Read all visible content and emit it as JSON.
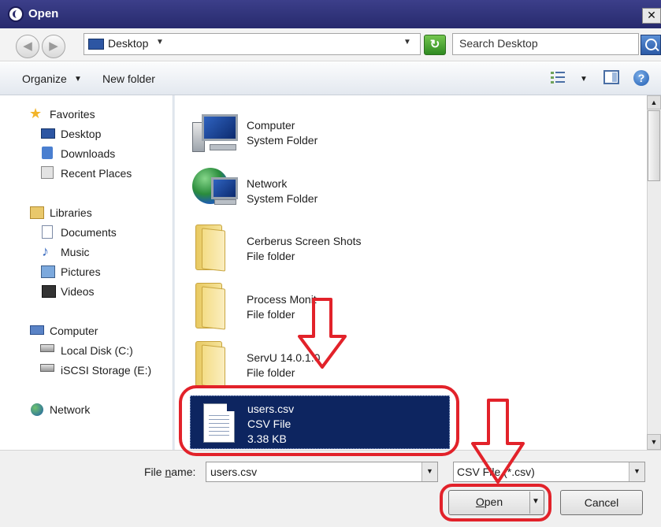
{
  "window": {
    "title": "Open",
    "close_glyph": "✕"
  },
  "address_bar": {
    "back_glyph": "◀",
    "forward_glyph": "▶",
    "location": "Desktop",
    "search_placeholder": "Search Desktop",
    "refresh_glyph": "↻"
  },
  "toolbar": {
    "organize_label": "Organize",
    "new_folder_label": "New folder",
    "help_glyph": "?"
  },
  "nav_pane": {
    "favorites": {
      "label": "Favorites",
      "items": [
        "Desktop",
        "Downloads",
        "Recent Places"
      ]
    },
    "libraries": {
      "label": "Libraries",
      "items": [
        "Documents",
        "Music",
        "Pictures",
        "Videos"
      ]
    },
    "computer": {
      "label": "Computer",
      "items": [
        "Local Disk (C:)",
        "iSCSI Storage (E:)"
      ]
    },
    "network": {
      "label": "Network"
    }
  },
  "files": [
    {
      "name": "Computer",
      "type": "System Folder",
      "icon": "computer-icon"
    },
    {
      "name": "Network",
      "type": "System Folder",
      "icon": "network-icon"
    },
    {
      "name": "Cerberus Screen Shots",
      "type": "File folder",
      "icon": "folder-icon"
    },
    {
      "name": "Process Monit",
      "type": "File folder",
      "icon": "folder-icon"
    },
    {
      "name": "ServU 14.0.1.0",
      "type": "File folder",
      "icon": "folder-icon"
    },
    {
      "name": "users.csv",
      "type": "CSV File",
      "size": "3.38 KB",
      "icon": "csv-file-icon",
      "selected": true
    }
  ],
  "bottom": {
    "file_name_label_pre": "File ",
    "file_name_label_ul": "n",
    "file_name_label_post": "ame:",
    "file_name_value": "users.csv",
    "file_type_filter": "CSV File (*.csv)",
    "open_label_ul": "O",
    "open_label_rest": "pen",
    "cancel_label": "Cancel"
  },
  "colors": {
    "annotation_red": "#e2222a",
    "selection_bg": "#0d2560",
    "titlebar": "#2f3278"
  }
}
